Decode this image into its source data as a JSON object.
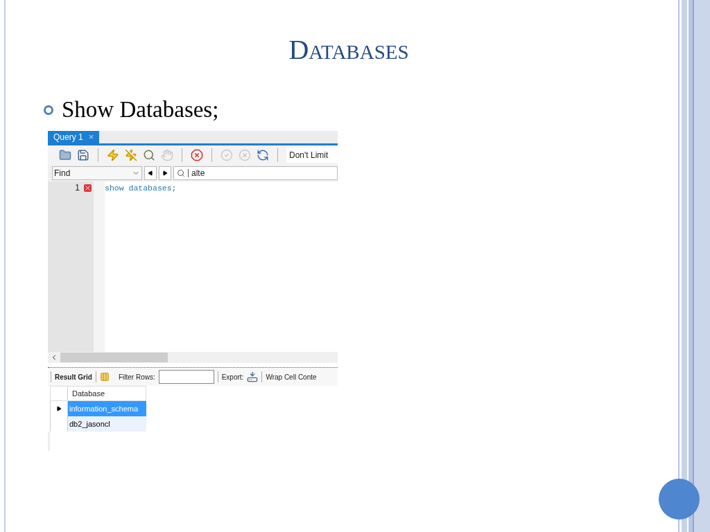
{
  "slide": {
    "title": "DATABASES",
    "bullet": "Show Databases;"
  },
  "workbench": {
    "tab": {
      "label": "Query 1",
      "selected": true,
      "close": "×"
    },
    "toolbar": {
      "icons": [
        {
          "kind": "folder",
          "disabled": false
        },
        {
          "kind": "save",
          "disabled": false
        },
        {
          "kind": "sep"
        },
        {
          "kind": "bolt",
          "disabled": false
        },
        {
          "kind": "bolt-cursor",
          "disabled": false
        },
        {
          "kind": "magnifier",
          "disabled": false
        },
        {
          "kind": "hand",
          "disabled": true
        },
        {
          "kind": "sep"
        },
        {
          "kind": "stop",
          "disabled": false
        },
        {
          "kind": "sep"
        },
        {
          "kind": "check",
          "disabled": true
        },
        {
          "kind": "cancel",
          "disabled": true
        },
        {
          "kind": "toggle",
          "disabled": false
        },
        {
          "kind": "sep"
        }
      ],
      "limit": "Don't Limit"
    },
    "find": {
      "mode": "Find",
      "search_value": "alte"
    },
    "editor": {
      "lines": [
        {
          "number": "1",
          "error": true,
          "code": "show databases;"
        }
      ]
    },
    "results": {
      "grid_label": "Result Grid",
      "filter_label": "Filter Rows:",
      "export_label": "Export:",
      "wrap_label": "Wrap Cell Conte"
    },
    "grid": {
      "column": "Database",
      "rows": [
        {
          "value": "information_schema",
          "selected": true
        },
        {
          "value": "db2_jasoncl",
          "selected": false
        }
      ]
    }
  }
}
